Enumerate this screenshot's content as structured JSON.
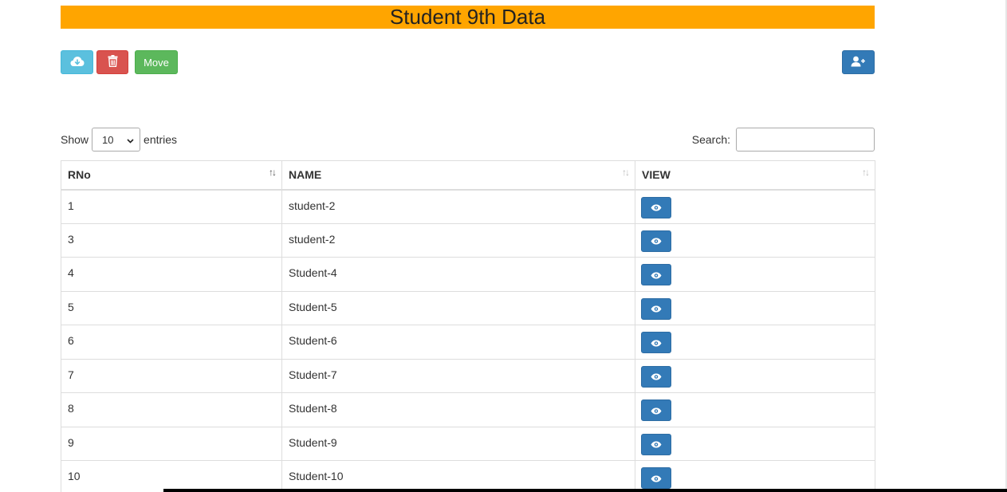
{
  "page": {
    "title": "Student 9th Data",
    "accent_color": "#ffa500"
  },
  "toolbar": {
    "download_icon": "cloud-download-icon",
    "delete_icon": "trash-icon",
    "move_label": "Move",
    "add_user_icon": "user-plus-icon"
  },
  "table_controls": {
    "show_label": "Show",
    "entries_value": "10",
    "entries_label": "entries",
    "search_label": "Search:",
    "search_value": ""
  },
  "table": {
    "columns": [
      "RNo",
      "NAME",
      "VIEW"
    ],
    "rows": [
      {
        "rno": "1",
        "name": "student-2"
      },
      {
        "rno": "3",
        "name": "student-2"
      },
      {
        "rno": "4",
        "name": "Student-4"
      },
      {
        "rno": "5",
        "name": "Student-5"
      },
      {
        "rno": "6",
        "name": "Student-6"
      },
      {
        "rno": "7",
        "name": "Student-7"
      },
      {
        "rno": "8",
        "name": "Student-8"
      },
      {
        "rno": "9",
        "name": "Student-9"
      },
      {
        "rno": "10",
        "name": "Student-10"
      }
    ],
    "view_icon": "eye-icon"
  }
}
